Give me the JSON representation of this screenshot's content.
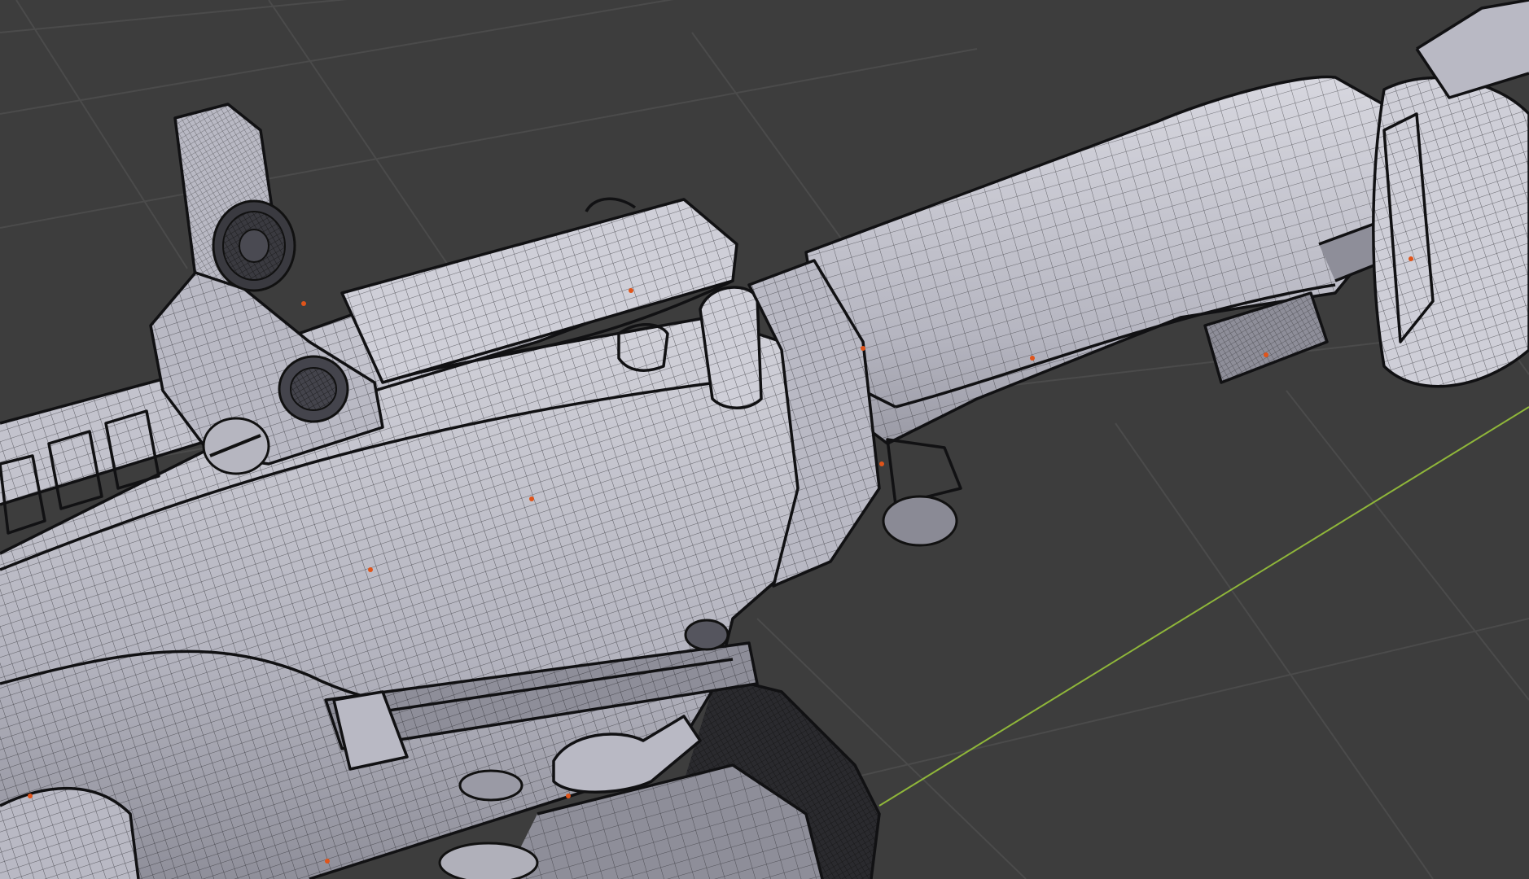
{
  "viewport": {
    "background": "#3d3d3d",
    "grid_color": "#4a4a4a",
    "x_axis_color": "#8fb63a",
    "mesh_surface_color": "#b9b9c4",
    "mesh_edge_color": "#111113",
    "vertex_color": "#e0541a"
  }
}
